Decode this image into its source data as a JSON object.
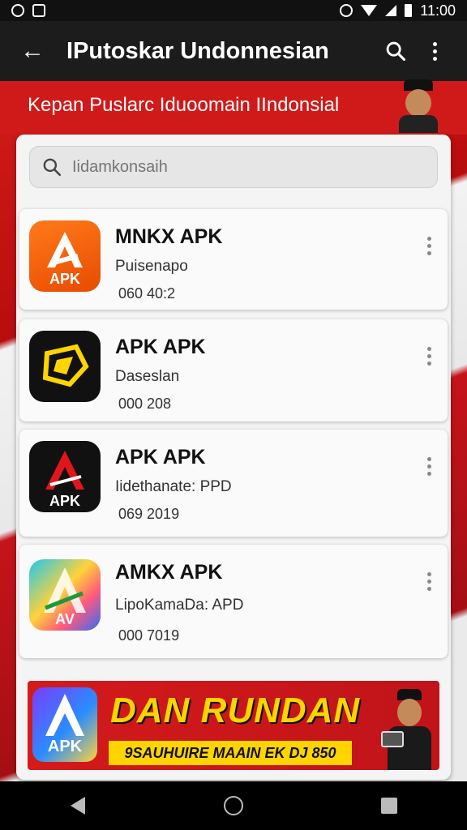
{
  "status_bar": {
    "time": "11:00"
  },
  "app_bar": {
    "title": "IPutoskar Undonnesian",
    "icons": [
      "arrow-back-icon",
      "search-icon",
      "more-vert-icon"
    ]
  },
  "banner_top": {
    "text": "Kepan Puslarc Iduoomain IIndonsial"
  },
  "search": {
    "placeholder": "Iidamkonsaih"
  },
  "apps": [
    {
      "title": "MNKX APK",
      "subtitle": "Puisenapo",
      "meta": "060 40:2",
      "icon": "apk-orange-icon",
      "icon_label": "APK"
    },
    {
      "title": "APK APK",
      "subtitle": "Daseslan",
      "meta": "000 208",
      "icon": "apk-black-yellow-icon",
      "icon_label": ""
    },
    {
      "title": "APK APK",
      "subtitle": "Iidethanate: PPD",
      "meta": "069 2019",
      "icon": "apk-black-red-icon",
      "icon_label": "APK"
    },
    {
      "title": "AMKX APK",
      "subtitle": "LipoKamaDa: APD",
      "meta": "000 7019",
      "icon": "apk-rainbow-icon",
      "icon_label": "AV"
    }
  ],
  "promo": {
    "title": "DAN RUNDAN",
    "subtitle": "9SAUHUIRE MAAIN EK DJ 850",
    "icon_label": "APK"
  },
  "colors": {
    "brand_red": "#d01a1a",
    "accent_yellow": "#ffd400",
    "app_bar": "#1c1c1c"
  }
}
